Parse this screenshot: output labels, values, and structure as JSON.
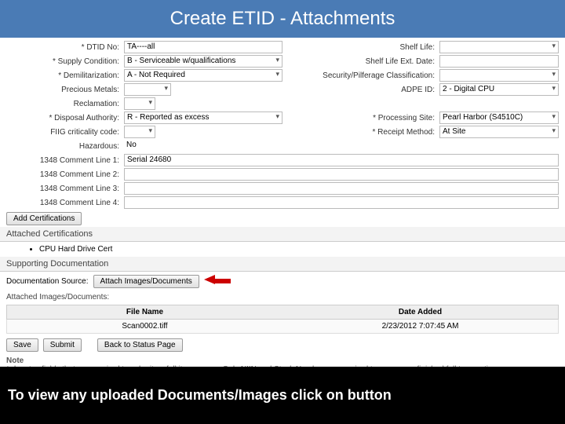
{
  "title": "Create ETID - Attachments",
  "form": {
    "dtidNo": {
      "label": "* DTID No:",
      "value": "TA----all"
    },
    "supplyCondition": {
      "label": "* Supply Condition:",
      "value": "B - Serviceable w/qualifications"
    },
    "demilitarization": {
      "label": "* Demilitarization:",
      "value": "A - Not Required"
    },
    "preciousMetals": {
      "label": "Precious Metals:",
      "value": ""
    },
    "reclamation": {
      "label": "Reclamation:",
      "value": ""
    },
    "disposalAuthority": {
      "label": "* Disposal Authority:",
      "value": "R - Reported as excess"
    },
    "fiigCriticality": {
      "label": "FIIG criticality code:",
      "value": ""
    },
    "hazardous": {
      "label": "Hazardous:",
      "value": "No"
    },
    "line1": {
      "label": "1348 Comment Line 1:",
      "value": "Serial 24680"
    },
    "line2": {
      "label": "1348 Comment Line 2:",
      "value": ""
    },
    "line3": {
      "label": "1348 Comment Line 3:",
      "value": ""
    },
    "line4": {
      "label": "1348 Comment Line 4:",
      "value": ""
    },
    "shelfLife": {
      "label": "Shelf Life:",
      "value": ""
    },
    "shelfLifeExt": {
      "label": "Shelf Life Ext. Date:",
      "value": ""
    },
    "securityClass": {
      "label": "Security/Pilferage Classification:",
      "value": ""
    },
    "adpeId": {
      "label": "ADPE ID:",
      "value": "2 - Digital CPU"
    },
    "processingSite": {
      "label": "* Processing Site:",
      "value": "Pearl Harbor (S4510C)"
    },
    "receiptMethod": {
      "label": "* Receipt Method:",
      "value": "At Site"
    }
  },
  "buttons": {
    "addCertifications": "Add Certifications",
    "attachImagesDocs": "Attach Images/Documents",
    "save": "Save",
    "submit": "Submit",
    "backToStatus": "Back to Status Page"
  },
  "sections": {
    "attachedCerts": "Attached Certifications",
    "supportingDocs": "Supporting Documentation",
    "docSourceLabel": "Documentation Source:",
    "attachedImgs": "Attached Images/Documents:"
  },
  "certs": [
    "CPU Hard Drive Cert"
  ],
  "table": {
    "headers": {
      "file": "File Name",
      "date": "Date Added"
    },
    "rows": [
      {
        "file": "Scan0002.tiff",
        "date": "2/23/2012 7:07:45 AM"
      }
    ]
  },
  "note": {
    "title": "Note",
    "body": "* denotes fields that are required to submit as full item survey. Only NIIN and Stock Number are required to save as unfinished full transaction."
  },
  "caption": "To view any uploaded Documents/Images click on button"
}
